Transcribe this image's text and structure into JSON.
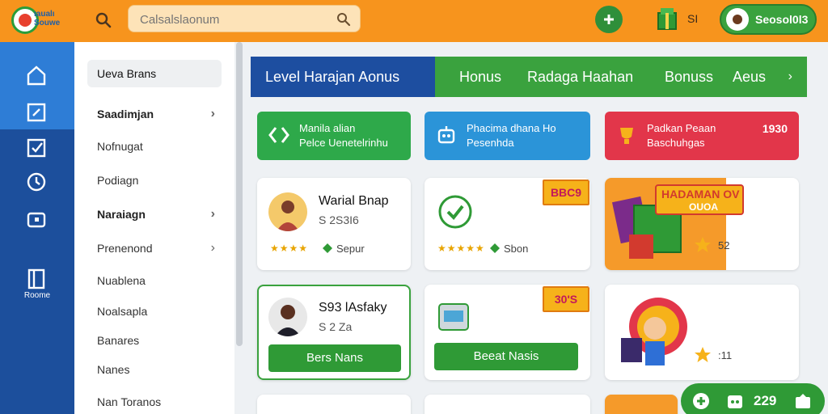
{
  "header": {
    "logo_text": "ıaualı\nSouwe",
    "search_placeholder": "Calsalslaonum",
    "coins": "SI",
    "profile_label": "Seosol0l3"
  },
  "sidebar": {
    "rail_label": "Roome",
    "items": [
      {
        "label": "Ueva Brans",
        "chevron": false
      },
      {
        "label": "Saadimjan",
        "chevron": true
      },
      {
        "label": "Nofnugat",
        "chevron": false
      },
      {
        "label": "Podiagn",
        "chevron": false
      },
      {
        "label": "Naraiagn",
        "chevron": true
      },
      {
        "label": "Prenenond",
        "chevron": true
      },
      {
        "label": "Nuablena",
        "chevron": false
      },
      {
        "label": "Noalsapla",
        "chevron": false
      },
      {
        "label": "Banares",
        "chevron": false
      },
      {
        "label": "Nanes",
        "chevron": false
      },
      {
        "label": "Nan Toranos",
        "chevron": false
      }
    ]
  },
  "tabs": {
    "first": "Level Harajan Aonus",
    "items": [
      "Honus",
      "Radaga Haahan",
      "Bonuss",
      "Aeus"
    ],
    "arrow": "›"
  },
  "promos": [
    {
      "line1": "Manila alian",
      "line2": "Pelce Uenetelrinhu",
      "amount": "",
      "color": "#2ea94a"
    },
    {
      "line1": "Phacima dhana Ho",
      "line2": "Pesenhda",
      "amount": "",
      "color": "#2b94d8"
    },
    {
      "line1": "Padkan Peaan",
      "line2": "Baschuhgas",
      "amount": "1930",
      "color": "#e2364a"
    }
  ],
  "cards": {
    "c1": {
      "title": "Warial Bnap",
      "sub": "S 2S3I6",
      "stars": "★★★★",
      "meta": "Sepur"
    },
    "c2": {
      "stars": "★★★★★",
      "meta": "Sbon",
      "ribbon": "BBC9"
    },
    "c3": {
      "banner": "HADAMAN OV",
      "sub": "OUOA",
      "meta": "52"
    },
    "c4": {
      "title": "S93 lAsfaky",
      "sub": "S 2 Za",
      "button": "Bers Nans"
    },
    "c5": {
      "ribbon": "30'S",
      "button": "Beeat Nasis"
    },
    "c6": {
      "meta": ":11"
    }
  },
  "bottom_pill": {
    "value": "229"
  },
  "colors": {
    "orange": "#f7941d",
    "green": "#3aa23e",
    "blue": "#1d4ea0"
  }
}
